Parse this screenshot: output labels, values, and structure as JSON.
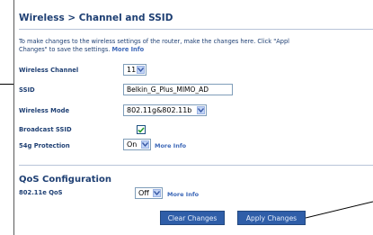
{
  "page": {
    "title": "Wireless > Channel and SSID",
    "intro_line1": "To make changes to the wireless settings of the router, make the changes here. Click \"Appl",
    "intro_line2_prefix": "Changes\" to save the settings.",
    "intro_more_info": "More Info"
  },
  "fields": {
    "wireless_channel": {
      "label": "Wireless Channel",
      "value": "11"
    },
    "ssid": {
      "label": "SSID",
      "value": "Belkin_G_Plus_MIMO_AD"
    },
    "wireless_mode": {
      "label": "Wireless Mode",
      "value": "802.11g&802.11b"
    },
    "broadcast_ssid": {
      "label": "Broadcast SSID",
      "checked": true
    },
    "protection_54g": {
      "label": "54g Protection",
      "value": "On",
      "more_info": "More Info"
    }
  },
  "qos": {
    "title": "QoS Configuration",
    "label": "802.11e QoS",
    "value": "Off",
    "more_info": "More Info"
  },
  "buttons": {
    "clear": "Clear Changes",
    "apply": "Apply Changes"
  },
  "colors": {
    "heading": "#1e3f73",
    "link": "#3d68b8",
    "button": "#2f5ea8"
  }
}
